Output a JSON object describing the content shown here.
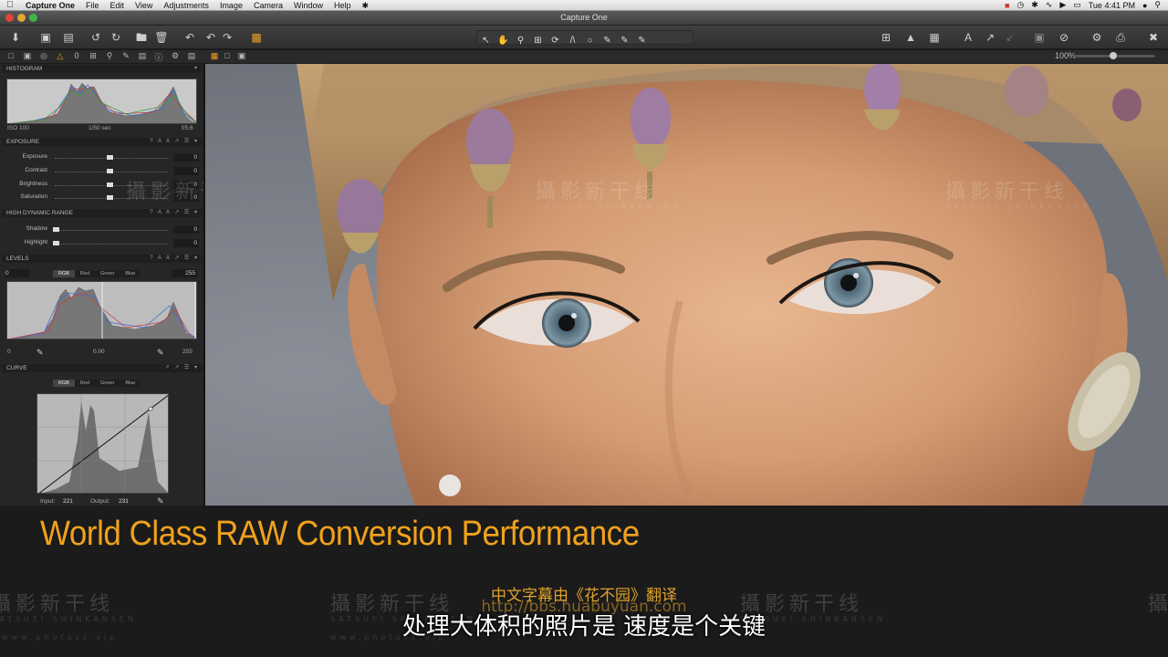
{
  "menubar": {
    "items": [
      "Capture One",
      "File",
      "Edit",
      "View",
      "Adjustments",
      "Image",
      "Camera",
      "Window",
      "Help"
    ],
    "clock": "Tue 4:41 PM"
  },
  "window": {
    "title": "Capture One"
  },
  "tools": {
    "histogram": {
      "title": "HISTOGRAM",
      "iso": "ISO 100",
      "shutter": "1/50 sec",
      "aperture": "f/5.6"
    },
    "exposure": {
      "title": "EXPOSURE",
      "sliders": [
        {
          "label": "Exposure",
          "value": "0"
        },
        {
          "label": "Contrast",
          "value": "0"
        },
        {
          "label": "Brightness",
          "value": "0"
        },
        {
          "label": "Saturation",
          "value": "0"
        }
      ]
    },
    "hdr": {
      "title": "HIGH DYNAMIC RANGE",
      "sliders": [
        {
          "label": "Shadow",
          "value": "0"
        },
        {
          "label": "Highlight",
          "value": "0"
        }
      ]
    },
    "levels": {
      "title": "LEVELS",
      "tabs": [
        "RGB",
        "Red",
        "Green",
        "Blue"
      ],
      "low": "0",
      "high": "255",
      "out_low": "0",
      "mid": "0.00",
      "out_high": "255"
    },
    "curve": {
      "title": "CURVE",
      "tabs": [
        "RGB",
        "Red",
        "Green",
        "Blue"
      ],
      "input_label": "Input:",
      "input_value": "221",
      "output_label": "Output:",
      "output_value": "231"
    }
  },
  "viewer": {
    "zoom": "100%"
  },
  "watermark": {
    "cn": "攝影新干线",
    "en": "SATSUEI SHINKANSEN",
    "url": "www.photoss.vip"
  },
  "caption": {
    "headline": "World Class RAW Conversion Performance",
    "credit": "中文字幕由《花不园》翻译",
    "url": "http://bbs.huabuyuan.com",
    "subtitle": "处理大体积的照片是 速度是个关键"
  },
  "colors": {
    "accent": "#f0a21c",
    "panel": "#262626",
    "toolbar": "#353535"
  }
}
